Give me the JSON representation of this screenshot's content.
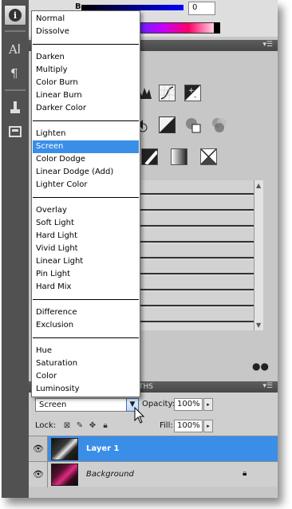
{
  "color_panel": {
    "channel_label": "B",
    "channel_value": "0"
  },
  "blend_menu": {
    "groups": [
      [
        "Normal",
        "Dissolve"
      ],
      [
        "Darken",
        "Multiply",
        "Color Burn",
        "Linear Burn",
        "Darker Color"
      ],
      [
        "Lighten",
        "Screen",
        "Color Dodge",
        "Linear Dodge (Add)",
        "Lighter Color"
      ],
      [
        "Overlay",
        "Soft Light",
        "Hard Light",
        "Vivid Light",
        "Linear Light",
        "Pin Light",
        "Hard Mix"
      ],
      [
        "Difference",
        "Exclusion"
      ],
      [
        "Hue",
        "Saturation",
        "Color",
        "Luminosity"
      ]
    ],
    "selected": "Screen",
    "selected_color": "#3b8ee8"
  },
  "layers_panel": {
    "tab_partial": "THS",
    "blend_mode_value": "Screen",
    "opacity_label": "Opacity:",
    "opacity_value": "100%",
    "lock_label": "Lock:",
    "fill_label": "Fill:",
    "fill_value": "100%",
    "layers": [
      {
        "name": "Layer 1",
        "selected": true,
        "italic": false
      },
      {
        "name": "Background",
        "selected": false,
        "italic": true,
        "locked": true
      }
    ],
    "selected_layer_color": "#3b8ee8"
  },
  "icons": {
    "toolstrip": [
      "info-icon",
      "character-icon",
      "paragraph-icon",
      "clone-source-icon",
      "tool-presets-icon"
    ]
  }
}
